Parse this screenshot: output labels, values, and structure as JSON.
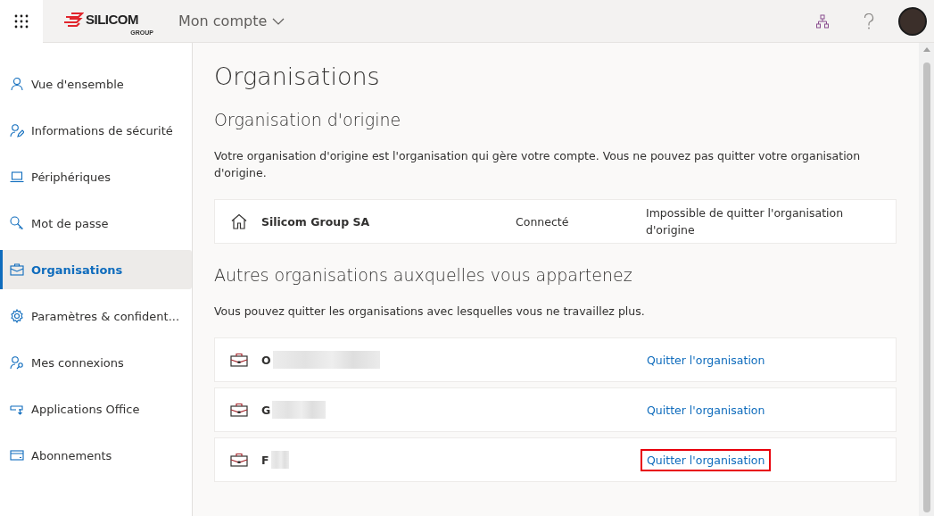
{
  "header": {
    "logo": {
      "name": "SILICOM",
      "sub": "GROUP"
    },
    "title": "Mon compte"
  },
  "sidebar": {
    "items": [
      {
        "label": "Vue d'ensemble",
        "selected": false
      },
      {
        "label": "Informations de sécurité",
        "selected": false
      },
      {
        "label": "Périphériques",
        "selected": false
      },
      {
        "label": "Mot de passe",
        "selected": false
      },
      {
        "label": "Organisations",
        "selected": true
      },
      {
        "label": "Paramètres & confident...",
        "selected": false
      },
      {
        "label": "Mes connexions",
        "selected": false
      },
      {
        "label": "Applications Office",
        "selected": false
      },
      {
        "label": "Abonnements",
        "selected": false
      }
    ]
  },
  "page": {
    "title": "Organisations",
    "home": {
      "heading": "Organisation d'origine",
      "description": "Votre organisation d'origine est l'organisation qui gère votre compte. Vous ne pouvez pas quitter votre organisation d'origine.",
      "name": "Silicom Group SA",
      "status": "Connecté",
      "note": "Impossible de quitter l'organisation d'origine"
    },
    "others": {
      "heading": "Autres organisations auxquelles vous appartenez",
      "description": "Vous pouvez quitter les organisations avec lesquelles vous ne travaillez plus.",
      "rows": [
        {
          "name": "O",
          "redacted": true,
          "action": "Quitter l'organisation",
          "highlighted": false
        },
        {
          "name": "G",
          "redacted": true,
          "action": "Quitter l'organisation",
          "highlighted": false
        },
        {
          "name": "F",
          "redacted": true,
          "action": "Quitter l'organisation",
          "highlighted": true
        }
      ]
    }
  }
}
